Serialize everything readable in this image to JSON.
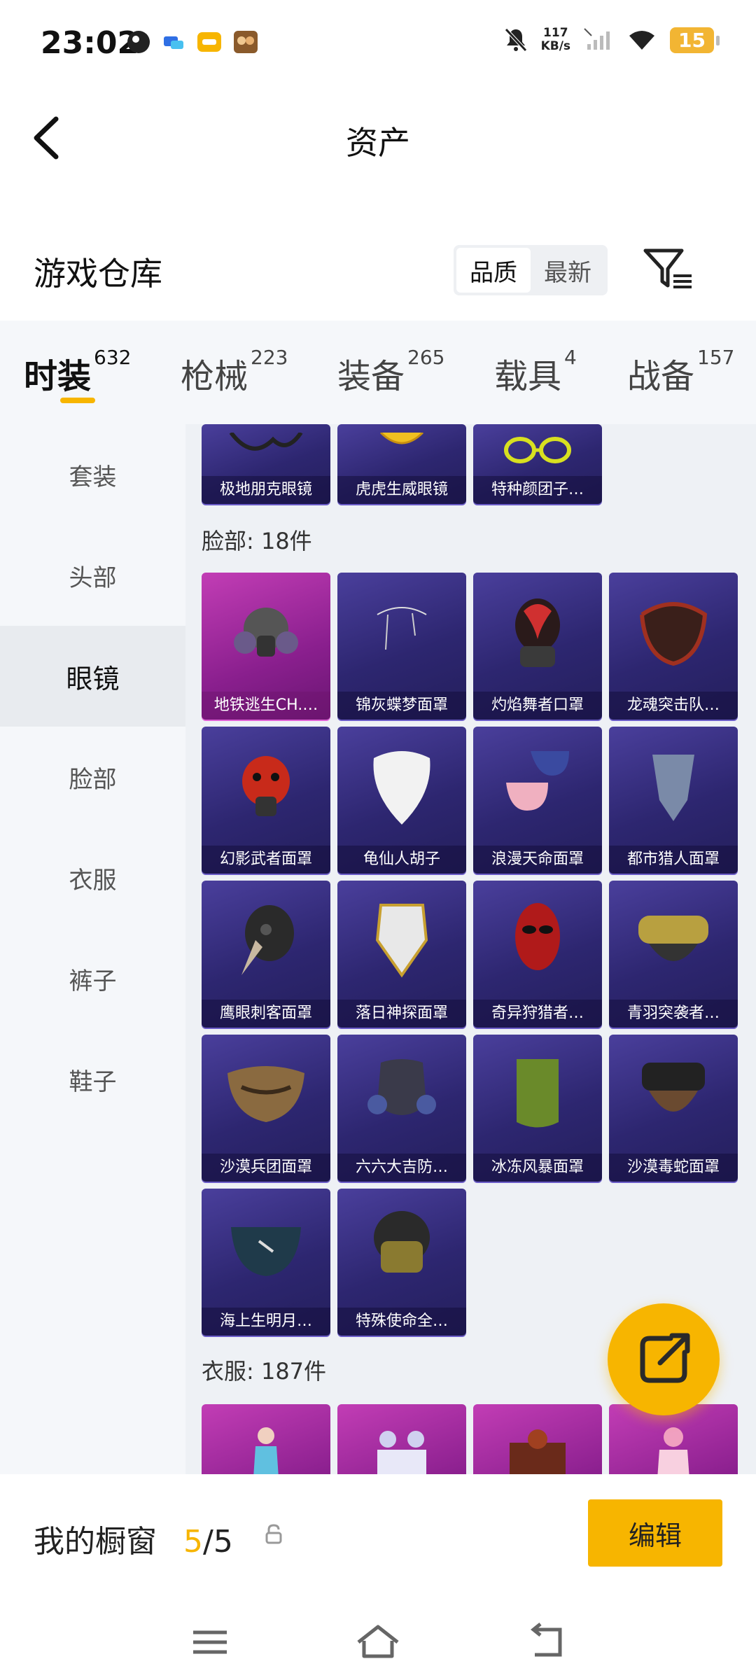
{
  "status_bar": {
    "time": "23:02",
    "net_speed_value": "117",
    "net_speed_unit": "KB/s",
    "battery": "15",
    "icons": [
      "app-icon-1",
      "chat-icon",
      "message-icon",
      "game-icon",
      "mute-icon",
      "signal-icon",
      "wifi-icon"
    ]
  },
  "header": {
    "title": "资产",
    "back_icon": "chevron-left-icon"
  },
  "warehouse": {
    "title": "游戏仓库",
    "sort_options": [
      "品质",
      "最新"
    ],
    "sort_selected": "品质",
    "filter_icon": "filter-icon"
  },
  "tabs": [
    {
      "label": "时装",
      "count": "632"
    },
    {
      "label": "枪械",
      "count": "223"
    },
    {
      "label": "装备",
      "count": "265"
    },
    {
      "label": "载具",
      "count": "4"
    },
    {
      "label": "战备",
      "count": "157"
    }
  ],
  "active_tab": "时装",
  "sidebar": {
    "items": [
      "套装",
      "头部",
      "眼镜",
      "脸部",
      "衣服",
      "裤子",
      "鞋子"
    ],
    "active": "眼镜"
  },
  "glasses_partial": [
    "极地朋克眼镜",
    "虎虎生威眼镜",
    "特种颜团子…"
  ],
  "face_section": {
    "label": "脸部: 18件",
    "items": [
      "地铁逃生CH.…",
      "锦灰蝶梦面罩",
      "灼焰舞者口罩",
      "龙魂突击队…",
      "幻影武者面罩",
      "龟仙人胡子",
      "浪漫天命面罩",
      "都市猎人面罩",
      "鹰眼刺客面罩",
      "落日神探面罩",
      "奇异狩猎者…",
      "青羽突袭者…",
      "沙漠兵团面罩",
      "六六大吉防…",
      "冰冻风暴面罩",
      "沙漠毒蛇面罩",
      "海上生明月…",
      "特殊使命全…"
    ]
  },
  "clothes_section": {
    "label": "衣服: 187件"
  },
  "fab_icon": "share-external-icon",
  "bottom": {
    "vitrine_label": "我的橱窗",
    "vitrine_current": "5",
    "vitrine_total": "/5",
    "lock_icon": "lock-icon",
    "edit_label": "编辑"
  },
  "nav": {
    "menu_icon": "menu-icon",
    "home_icon": "home-icon",
    "back_icon": "back-icon"
  },
  "colors": {
    "accent": "#f7b500",
    "card_purple": "#2d2670",
    "card_pink": "#a0239e"
  }
}
